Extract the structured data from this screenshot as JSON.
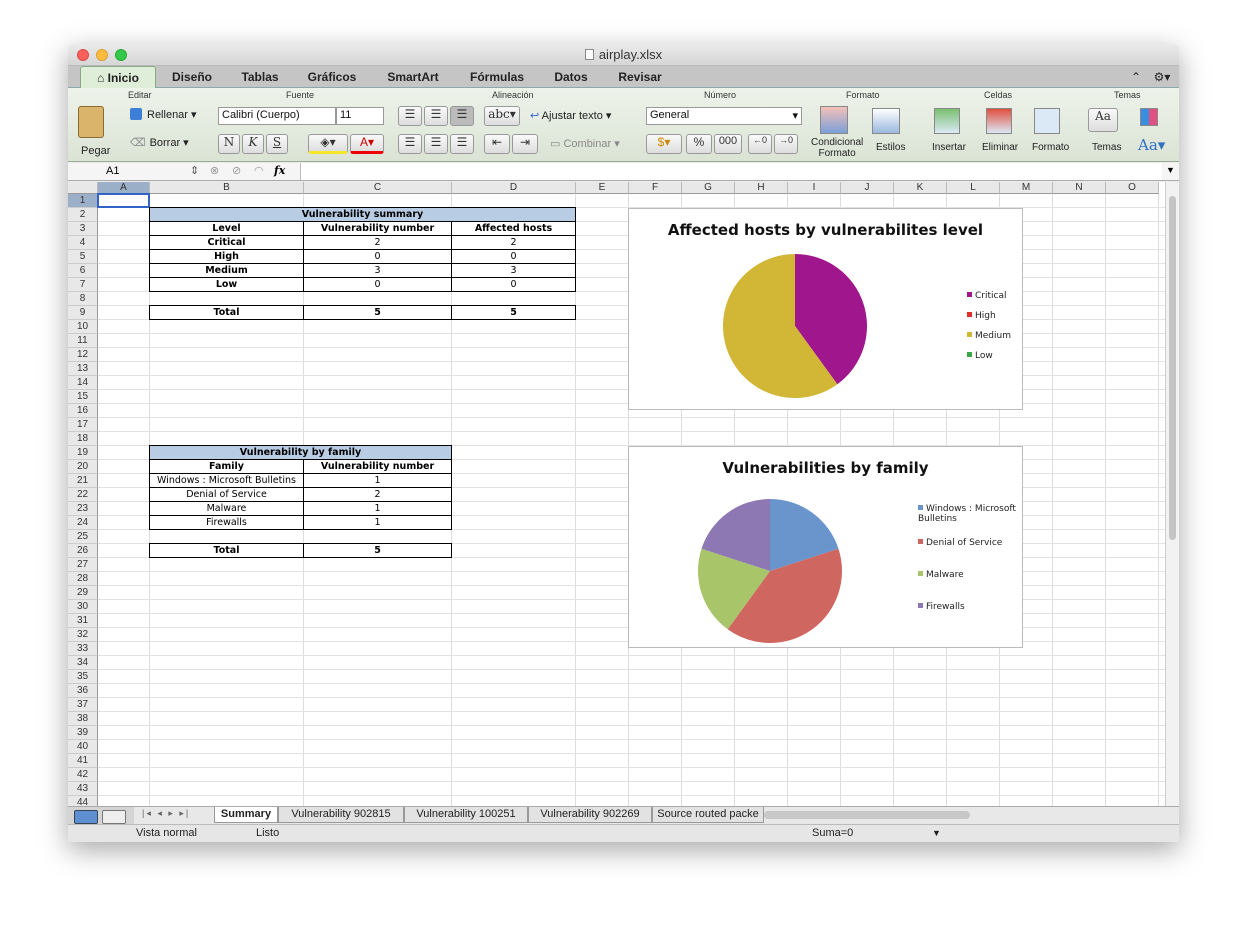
{
  "window": {
    "title": "airplay.xlsx"
  },
  "menu_tabs": [
    "Inicio",
    "Diseño",
    "Tablas",
    "Gráficos",
    "SmartArt",
    "Fórmulas",
    "Datos",
    "Revisar"
  ],
  "ribbon": {
    "groups": [
      "Editar",
      "Fuente",
      "Alineación",
      "Número",
      "Formato",
      "Celdas",
      "Temas"
    ],
    "paste": "Pegar",
    "fill": "Rellenar",
    "clear": "Borrar",
    "font_name": "Calibri (Cuerpo)",
    "font_size": "11",
    "bold": "N",
    "italic": "K",
    "underline": "S",
    "wrap_text": "Ajustar texto",
    "merge": "Combinar",
    "abc": "abc",
    "number_format": "General",
    "percent": "%",
    "thousands": "000",
    "conditional": "Condicional",
    "conditional2": "Formato",
    "styles": "Estilos",
    "insert": "Insertar",
    "delete": "Eliminar",
    "format": "Formato",
    "themes": "Temas",
    "aa": "Aa"
  },
  "formula_bar": {
    "cell_ref": "A1",
    "fx": "fx",
    "value": ""
  },
  "columns": [
    "A",
    "B",
    "C",
    "D",
    "E",
    "F",
    "G",
    "H",
    "I",
    "J",
    "K",
    "L",
    "M",
    "N",
    "O"
  ],
  "rows": [
    "1",
    "2",
    "3",
    "4",
    "5",
    "6",
    "7",
    "8",
    "9",
    "10",
    "11",
    "12",
    "13",
    "14",
    "15",
    "16",
    "17",
    "18",
    "19",
    "20",
    "21",
    "22",
    "23",
    "24",
    "25",
    "26",
    "27",
    "28",
    "29",
    "30",
    "31",
    "32",
    "33",
    "34",
    "35",
    "36",
    "37",
    "38",
    "39",
    "40",
    "41",
    "42",
    "43",
    "44"
  ],
  "summary_table": {
    "title": "Vulnerability summary",
    "headers": [
      "Level",
      "Vulnerability number",
      "Affected hosts"
    ],
    "rows": [
      [
        "Critical",
        "2",
        "2"
      ],
      [
        "High",
        "0",
        "0"
      ],
      [
        "Medium",
        "3",
        "3"
      ],
      [
        "Low",
        "0",
        "0"
      ]
    ],
    "total": [
      "Total",
      "5",
      "5"
    ]
  },
  "family_table": {
    "title": "Vulnerability by family",
    "headers": [
      "Family",
      "Vulnerability number"
    ],
    "rows": [
      [
        "Windows : Microsoft Bulletins",
        "1"
      ],
      [
        "Denial of Service",
        "2"
      ],
      [
        "Malware",
        "1"
      ],
      [
        "Firewalls",
        "1"
      ]
    ],
    "total": [
      "Total",
      "5"
    ]
  },
  "chart_data": [
    {
      "type": "pie",
      "title": "Affected hosts by vulnerabilites level",
      "categories": [
        "Critical",
        "High",
        "Medium",
        "Low"
      ],
      "values": [
        2,
        0,
        3,
        0
      ],
      "colors": [
        "#a0168c",
        "#e0302a",
        "#d2b636",
        "#3aa845"
      ],
      "legend": "right"
    },
    {
      "type": "pie",
      "title": "Vulnerabilities by family",
      "categories": [
        "Windows : Microsoft Bulletins",
        "Denial of Service",
        "Malware",
        "Firewalls"
      ],
      "values": [
        1,
        2,
        1,
        1
      ],
      "colors": [
        "#6a94cc",
        "#cf6760",
        "#a8c56a",
        "#8e78b4"
      ],
      "legend": "right"
    }
  ],
  "sheets": [
    "Summary",
    "Vulnerability 902815",
    "Vulnerability 100251",
    "Vulnerability 902269",
    "Source routed packe"
  ],
  "status": {
    "view": "Vista normal",
    "ready": "Listo",
    "sum": "Suma=0"
  }
}
